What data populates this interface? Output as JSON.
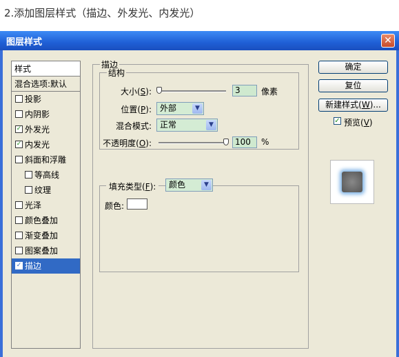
{
  "caption": "2.添加图层样式（描边、外发光、内发光）",
  "window": {
    "title": "图层样式",
    "close_glyph": "✕"
  },
  "style_list": {
    "header": "样式",
    "items": [
      {
        "label": "混合选项:默认",
        "checkbox": false,
        "checked": false,
        "selected": false,
        "indent": false
      },
      {
        "label": "投影",
        "checkbox": true,
        "checked": false,
        "selected": false,
        "indent": false
      },
      {
        "label": "内阴影",
        "checkbox": true,
        "checked": false,
        "selected": false,
        "indent": false
      },
      {
        "label": "外发光",
        "checkbox": true,
        "checked": true,
        "selected": false,
        "indent": false
      },
      {
        "label": "内发光",
        "checkbox": true,
        "checked": true,
        "selected": false,
        "indent": false
      },
      {
        "label": "斜面和浮雕",
        "checkbox": true,
        "checked": false,
        "selected": false,
        "indent": false
      },
      {
        "label": "等高线",
        "checkbox": true,
        "checked": false,
        "selected": false,
        "indent": true
      },
      {
        "label": "纹理",
        "checkbox": true,
        "checked": false,
        "selected": false,
        "indent": true
      },
      {
        "label": "光泽",
        "checkbox": true,
        "checked": false,
        "selected": false,
        "indent": false
      },
      {
        "label": "颜色叠加",
        "checkbox": true,
        "checked": false,
        "selected": false,
        "indent": false
      },
      {
        "label": "渐变叠加",
        "checkbox": true,
        "checked": false,
        "selected": false,
        "indent": false
      },
      {
        "label": "图案叠加",
        "checkbox": true,
        "checked": false,
        "selected": false,
        "indent": false
      },
      {
        "label": "描边",
        "checkbox": true,
        "checked": true,
        "selected": true,
        "indent": false
      }
    ]
  },
  "stroke": {
    "legend": "描边",
    "structure_legend": "结构",
    "size": {
      "label": "大小(",
      "key": "S",
      "label_end": "):",
      "value": "3",
      "unit": "像素"
    },
    "position": {
      "label": "位置(",
      "key": "P",
      "label_end": "):",
      "value": "外部"
    },
    "blend_mode": {
      "label": "混合模式:",
      "value": "正常"
    },
    "opacity": {
      "label": "不透明度(",
      "key": "O",
      "label_end": "):",
      "value": "100",
      "unit": "%"
    },
    "fill_type": {
      "label": "填充类型(",
      "key": "F",
      "label_end": "):",
      "value": "颜色"
    },
    "color": {
      "label": "颜色:",
      "value_hex": "#ffffff"
    }
  },
  "buttons": {
    "ok": "确定",
    "reset": "复位",
    "new_style": {
      "label": "新建样式(",
      "key": "W",
      "label_end": ")..."
    },
    "preview": {
      "label": "预览(",
      "key": "V",
      "label_end": ")",
      "checked": true
    }
  },
  "colors": {
    "title_bar": "#1f5fd6",
    "selection": "#316ac5",
    "panel": "#ece9d8",
    "glow": "#7fb4e6"
  },
  "icons": {
    "close": "close-icon",
    "check": "check-icon",
    "dropdown": "chevron-down-icon"
  }
}
